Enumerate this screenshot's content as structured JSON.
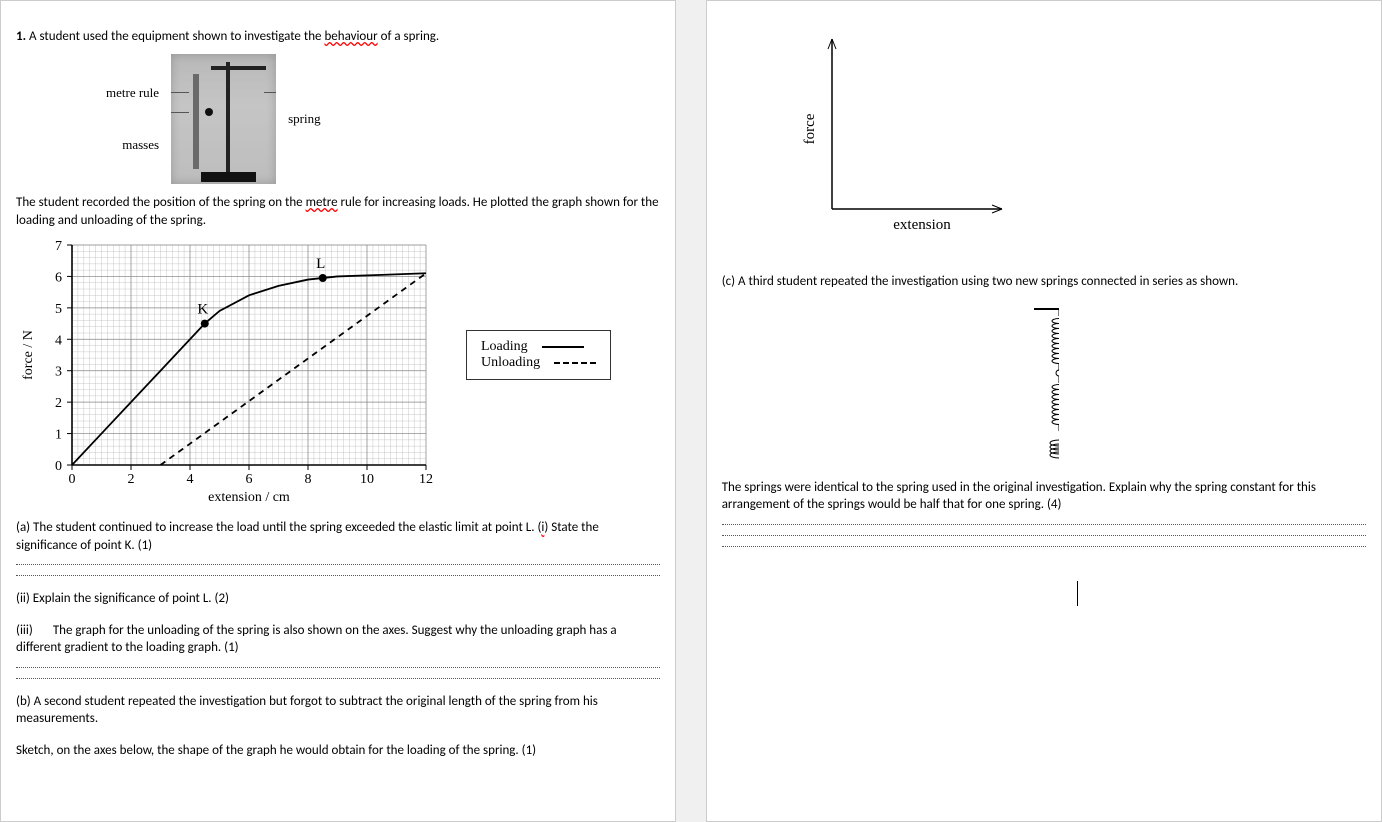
{
  "q1": {
    "number": "1.",
    "intro": "A student used the equipment shown to investigate the ",
    "intro_spell": "behaviour",
    "intro_end": " of a spring.",
    "apparatus": {
      "metre_rule": "metre rule",
      "masses": "masses",
      "spring": "spring"
    },
    "para2a": "The student recorded the position of the spring on the ",
    "para2_spell": "metre",
    "para2b": " rule for increasing loads. He plotted the graph shown for the loading and unloading of the spring.",
    "legend": {
      "loading": "Loading",
      "unloading": "Unloading"
    },
    "a": {
      "text_i": "(a) The student continued to increase the load until the spring exceeded the elastic limit at point L. (",
      "i_red": "i",
      "text_i_end": ") State the significance of point K. (1)",
      "text_ii": "(ii) Explain the significance of point L. (2)",
      "text_iii_label": "(iii)",
      "text_iii": "The graph for the unloading of the spring is also shown on the axes. Suggest why the unloading graph has a different gradient to the loading graph. (1)"
    },
    "b": {
      "label": "(b)",
      "text": "A second student repeated the investigation but forgot to subtract the original length of the spring from his measurements.",
      "sketch": "Sketch, on the axes below, the shape of the graph he would obtain for the loading of the spring. (1)"
    },
    "axes2": {
      "ylabel": "force",
      "xlabel": "extension"
    },
    "c": {
      "intro": "(c) A third student repeated the investigation using two new springs connected in series as shown.",
      "explain": "The springs were identical to the spring used in the original investigation. Explain why the spring constant for this arrangement of the springs would be half that for one spring. (4)"
    }
  },
  "chart_data": {
    "type": "line",
    "title": "",
    "xlabel": "extension / cm",
    "ylabel": "force / N",
    "xlim": [
      0,
      12
    ],
    "ylim": [
      0,
      7
    ],
    "xticks": [
      0,
      2,
      4,
      6,
      8,
      10,
      12
    ],
    "yticks": [
      0,
      1,
      2,
      3,
      4,
      5,
      6,
      7
    ],
    "series": [
      {
        "name": "Loading",
        "style": "solid",
        "x": [
          0,
          1,
          2,
          3,
          4,
          4.5,
          5,
          6,
          7,
          8,
          9,
          10.5,
          12
        ],
        "y": [
          0,
          1,
          2,
          3,
          4,
          4.5,
          4.9,
          5.4,
          5.7,
          5.9,
          6.0,
          6.05,
          6.1
        ],
        "labeled_points": [
          {
            "name": "K",
            "x": 4.5,
            "y": 4.5
          },
          {
            "name": "L",
            "x": 8.5,
            "y": 5.95
          }
        ]
      },
      {
        "name": "Unloading",
        "style": "dashed",
        "x": [
          3,
          12
        ],
        "y": [
          0,
          6.1
        ]
      }
    ],
    "grid": true
  }
}
